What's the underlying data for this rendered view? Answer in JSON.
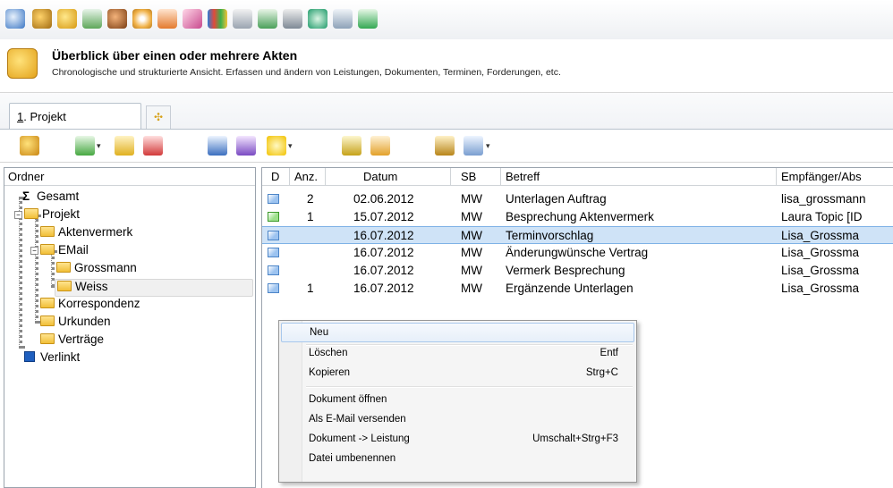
{
  "toolbar": {
    "icons": [
      "search-icon",
      "contacts-icon",
      "folder-open-icon",
      "calendar-icon",
      "users-icon",
      "cd-icon",
      "notes-icon",
      "finance-icon",
      "books-icon",
      "chart-icon",
      "report-icon",
      "court-icon",
      "sync-icon",
      "calculator-icon",
      "text-icon"
    ]
  },
  "header": {
    "title": "Überblick über einen oder mehrere Akten",
    "subtitle": "Chronologische und strukturierte Ansicht. Erfassen und ändern von Leistungen, Dokumenten, Terminen, Forderungen, etc."
  },
  "tabs": {
    "active_prefix": "1",
    "active_label": ". Projekt"
  },
  "tree": {
    "header": "Ordner",
    "nodes": {
      "gesamt": "Gesamt",
      "projekt": "Projekt",
      "aktenvermerk": "Aktenvermerk",
      "email": "EMail",
      "grossmann": "Grossmann",
      "weiss": "Weiss",
      "korrespondenz": "Korrespondenz",
      "urkunden": "Urkunden",
      "vertraege": "Verträge",
      "verlinkt": "Verlinkt"
    }
  },
  "table": {
    "columns": [
      "D",
      "Anz.",
      "Datum",
      "SB",
      "Betreff",
      "Empfänger/Abs"
    ],
    "rows": [
      {
        "anz": "2",
        "datum": "02.06.2012",
        "sb": "MW",
        "betreff": "Unterlagen Auftrag",
        "empf": "lisa_grossmann"
      },
      {
        "anz": "1",
        "datum": "15.07.2012",
        "sb": "MW",
        "betreff": "Besprechung Aktenvermerk",
        "empf": "Laura Topic  [ID"
      },
      {
        "anz": "",
        "datum": "16.07.2012",
        "sb": "MW",
        "betreff": "Terminvorschlag",
        "empf": "Lisa_Grossma"
      },
      {
        "anz": "",
        "datum": "16.07.2012",
        "sb": "MW",
        "betreff": "Änderungwünsche Vertrag",
        "empf": "Lisa_Grossma"
      },
      {
        "anz": "",
        "datum": "16.07.2012",
        "sb": "MW",
        "betreff": "Vermerk Besprechung",
        "empf": "Lisa_Grossma"
      },
      {
        "anz": "1",
        "datum": "16.07.2012",
        "sb": "MW",
        "betreff": "Ergänzende Unterlagen",
        "empf": "Lisa_Grossma"
      }
    ]
  },
  "context_menu": {
    "items": [
      {
        "label": "Neu",
        "shortcut": ""
      },
      {
        "label": "Löschen",
        "shortcut": "Entf"
      },
      {
        "label": "Kopieren",
        "shortcut": "Strg+C"
      },
      {
        "label": "Dokument öffnen",
        "shortcut": ""
      },
      {
        "label": "Als E-Mail versenden",
        "shortcut": ""
      },
      {
        "label": "Dokument -> Leistung",
        "shortcut": "Umschalt+Strg+F3"
      },
      {
        "label": "Datei umbenennen",
        "shortcut": ""
      }
    ]
  }
}
